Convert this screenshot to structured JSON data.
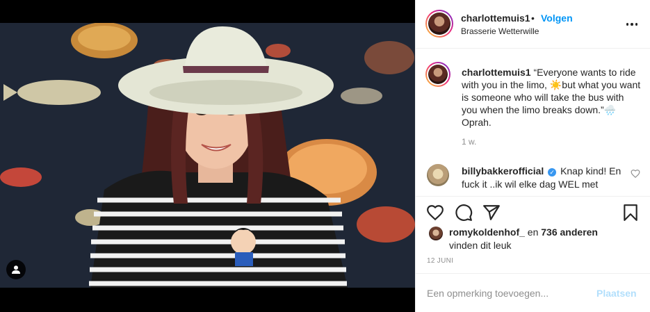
{
  "header": {
    "username": "charlottemuis1",
    "separator": "•",
    "follow_label": "Volgen",
    "location": "Brasserie Wetterwille"
  },
  "caption": {
    "username": "charlottemuis1",
    "text_part1": "“Everyone wants to ride with you in the limo, ",
    "emoji_sun": "☀️",
    "text_part2": "but what you want is someone who will take the bus with you when the limo breaks down.”",
    "emoji_rain": "🌧️",
    "text_part3": " Oprah.",
    "time": "1 w."
  },
  "comment": {
    "username": "billybakkerofficial",
    "verified_glyph": "✓",
    "text": "Knap kind! En fuck it ..ik wil elke dag WEL met"
  },
  "likes": {
    "username": "romykoldenhof_",
    "and_label": "en",
    "count": "736 anderen",
    "suffix": "vinden dit leuk"
  },
  "date": "12 JUNI",
  "add_comment": {
    "placeholder": "Een opmerking toevoegen...",
    "post_label": "Plaatsen"
  },
  "icons": [
    "user-tag-icon",
    "more-options-icon",
    "heart-icon",
    "comment-icon",
    "share-icon",
    "bookmark-icon",
    "small-heart-icon",
    "verified-badge-icon"
  ],
  "colors": {
    "link_blue": "#0095f6",
    "muted": "#8e8e8e",
    "post_disabled": "#b2dffc",
    "border": "#efefef"
  }
}
